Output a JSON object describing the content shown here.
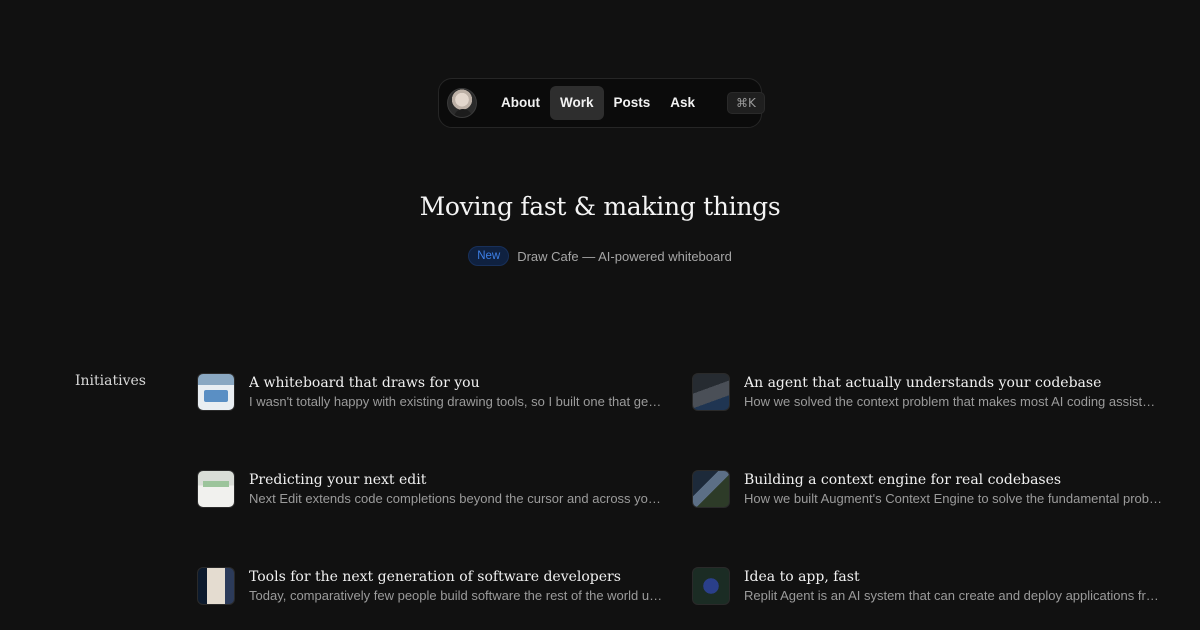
{
  "nav": {
    "items": [
      {
        "label": "About",
        "active": false
      },
      {
        "label": "Work",
        "active": true
      },
      {
        "label": "Posts",
        "active": false
      },
      {
        "label": "Ask",
        "active": false
      }
    ],
    "shortcut": "⌘K",
    "avatar_icon": "user-avatar-icon"
  },
  "hero": {
    "title": "Moving fast & making things",
    "badge": "New",
    "announcement": "Draw Cafe — AI-powered whiteboard"
  },
  "initiatives": {
    "label": "Initiatives",
    "items": [
      {
        "title": "A whiteboard that draws for you",
        "desc": "I wasn't totally happy with existing drawing tools, so I built one that generates diagrams for you"
      },
      {
        "title": "An agent that actually understands your codebase",
        "desc": "How we solved the context problem that makes most AI coding assistants fail"
      },
      {
        "title": "Predicting your next edit",
        "desc": "Next Edit extends code completions beyond the cursor and across your codebase"
      },
      {
        "title": "Building a context engine for real codebases",
        "desc": "How we built Augment's Context Engine to solve the fundamental problem"
      },
      {
        "title": "Tools for the next generation of software developers",
        "desc": "Today, comparatively few people build software the rest of the world uses"
      },
      {
        "title": "Idea to app, fast",
        "desc": "Replit Agent is an AI system that can create and deploy applications from a prompt"
      }
    ]
  },
  "colors": {
    "background": "#111111",
    "badge_text": "#3d7fe6",
    "badge_bg": "#0f2140"
  }
}
